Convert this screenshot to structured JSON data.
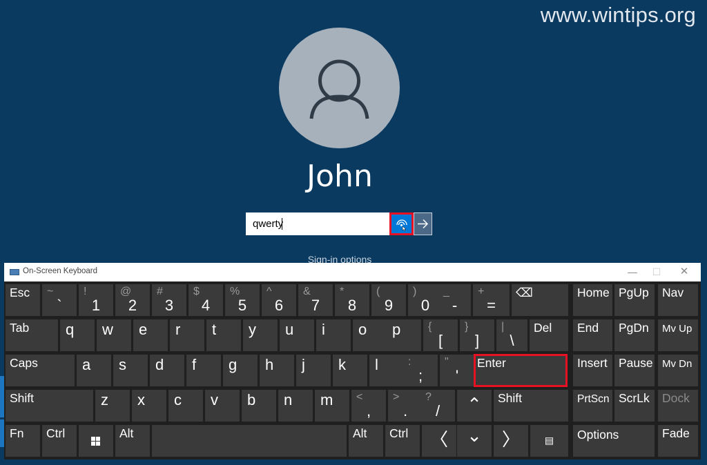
{
  "watermark": "www.wintips.org",
  "user": {
    "name": "John"
  },
  "password": {
    "value": "qwerty",
    "reveal_icon": "eye-icon",
    "submit_icon": "arrow-right-icon"
  },
  "sign_in_options": "Sign-in options",
  "osk": {
    "title": "On-Screen Keyboard",
    "controls": {
      "minimize": "—",
      "maximize": "☐",
      "close": "✕"
    },
    "keys": {
      "esc": "Esc",
      "tilde_shift": "~",
      "tilde": "`",
      "k1_shift": "!",
      "k1": "1",
      "k2_shift": "@",
      "k2": "2",
      "k3_shift": "#",
      "k3": "3",
      "k4_shift": "$",
      "k4": "4",
      "k5_shift": "%",
      "k5": "5",
      "k6_shift": "^",
      "k6": "6",
      "k7_shift": "&",
      "k7": "7",
      "k8_shift": "*",
      "k8": "8",
      "k9_shift": "(",
      "k9": "9",
      "k0_shift": ")",
      "k0": "0",
      "minus_shift": "_",
      "minus": "-",
      "equals_shift": "+",
      "equals": "=",
      "backspace_icon": "⌫",
      "home": "Home",
      "pgup": "PgUp",
      "nav": "Nav",
      "tab": "Tab",
      "q": "q",
      "w": "w",
      "e": "e",
      "r": "r",
      "t": "t",
      "y": "y",
      "u": "u",
      "i": "i",
      "o": "o",
      "p": "p",
      "lbracket_shift": "{",
      "lbracket": "[",
      "rbracket_shift": "}",
      "rbracket": "]",
      "backslash_shift": "|",
      "backslash": "\\",
      "del": "Del",
      "end": "End",
      "pgdn": "PgDn",
      "mvup": "Mv Up",
      "caps": "Caps",
      "a": "a",
      "s": "s",
      "d": "d",
      "f": "f",
      "g": "g",
      "h": "h",
      "j": "j",
      "k": "k",
      "l": "l",
      "semicolon_shift": ":",
      "semicolon": ";",
      "quote_shift": "\"",
      "quote": "'",
      "enter": "Enter",
      "insert": "Insert",
      "pause": "Pause",
      "mvdn": "Mv Dn",
      "shift": "Shift",
      "z": "z",
      "x": "x",
      "c": "c",
      "v": "v",
      "b": "b",
      "n": "n",
      "m": "m",
      "comma_shift": "<",
      "comma": ",",
      "period_shift": ">",
      "period": ".",
      "slash_shift": "?",
      "slash": "/",
      "up_arrow": "⌃",
      "shift_right": "Shift",
      "prtscn": "PrtScn",
      "scrlk": "ScrLk",
      "dock": "Dock",
      "fn": "Fn",
      "ctrl": "Ctrl",
      "win_icon": "windows-icon",
      "alt": "Alt",
      "alt_right": "Alt",
      "ctrl_right": "Ctrl",
      "left_arrow": "〈",
      "down_arrow": "⌄",
      "right_arrow": "〉",
      "menu_icon": "▤",
      "options": "Options",
      "fade": "Fade"
    }
  },
  "colors": {
    "background": "#0b3a60",
    "accent": "#0078d7",
    "highlight": "#e81123",
    "key": "#3a3a3a"
  }
}
